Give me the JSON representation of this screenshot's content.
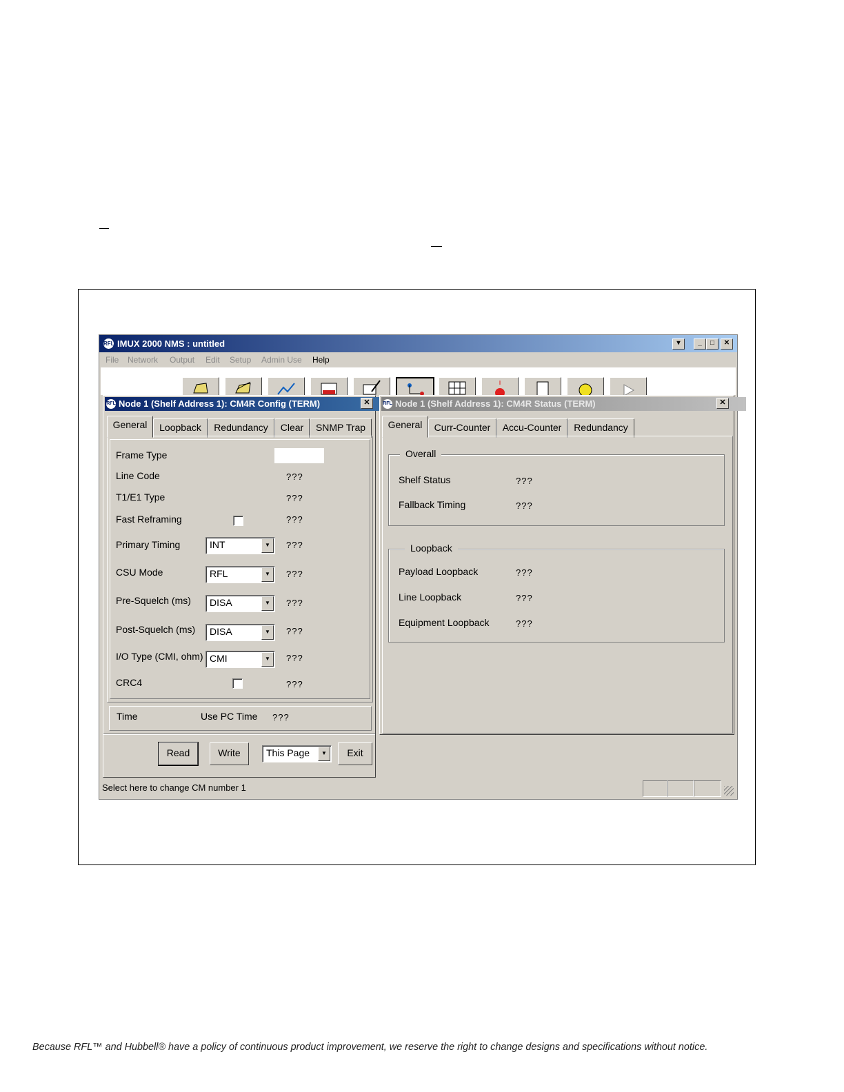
{
  "app": {
    "title": "IMUX 2000 NMS  : untitled",
    "logo": "RFL",
    "menu": [
      "File",
      "Network",
      "Output",
      "Edit",
      "Setup",
      "Admin Use",
      "Help"
    ],
    "toolbar_icons": [
      "open-folder-icon",
      "edit-folder-icon",
      "network-map-icon",
      "poll-icon",
      "na-edit-icon",
      "node-icon",
      "ufis-grid-icon",
      "alarm-light-icon",
      "document-icon",
      "search-icon",
      "play-icon"
    ],
    "status_text": "Select here to change CM number 1"
  },
  "config": {
    "title": "Node 1 (Shelf Address 1): CM4R Config (TERM)",
    "tabs": [
      "General",
      "Loopback",
      "Redundancy",
      "Clear",
      "SNMP Trap"
    ],
    "frame_type_label": "Frame Type",
    "line_code_label": "Line Code",
    "line_code_value": "???",
    "t1e1_label": "T1/E1 Type",
    "t1e1_value": "???",
    "fast_reframing_label": "Fast Reframing",
    "fast_reframing_value": "???",
    "primary_timing_label": "Primary Timing",
    "primary_timing_sel": "INT",
    "primary_timing_value": "???",
    "csu_mode_label": "CSU Mode",
    "csu_mode_sel": "RFL",
    "csu_mode_value": "???",
    "pre_squelch_label": "Pre-Squelch (ms)",
    "pre_squelch_sel": "DISA",
    "pre_squelch_value": "???",
    "post_squelch_label": "Post-Squelch (ms)",
    "post_squelch_sel": "DISA",
    "post_squelch_value": "???",
    "io_type_label": "I/O Type (CMI, ohm)",
    "io_type_sel": "CMI",
    "io_type_value": "???",
    "crc4_label": "CRC4",
    "crc4_value": "???",
    "time_label": "Time",
    "use_pc_time_label": "Use PC Time",
    "time_value": "???",
    "read_label": "Read",
    "write_label": "Write",
    "scope_sel": "This Page",
    "exit_label": "Exit"
  },
  "status": {
    "title": "Node 1 (Shelf Address 1): CM4R Status (TERM)",
    "tabs": [
      "General",
      "Curr-Counter",
      "Accu-Counter",
      "Redundancy"
    ],
    "overall_legend": "Overall",
    "shelf_status_label": "Shelf Status",
    "shelf_status_value": "???",
    "fallback_timing_label": "Fallback Timing",
    "fallback_timing_value": "???",
    "loopback_legend": "Loopback",
    "payload_loopback_label": "Payload Loopback",
    "payload_loopback_value": "???",
    "line_loopback_label": "Line Loopback",
    "line_loopback_value": "???",
    "equipment_loopback_label": "Equipment Loopback",
    "equipment_loopback_value": "???"
  },
  "footer": {
    "text": "Because RFL™ and Hubbell® have a policy of continuous product improvement, we reserve the right to change designs and specifications without notice."
  }
}
